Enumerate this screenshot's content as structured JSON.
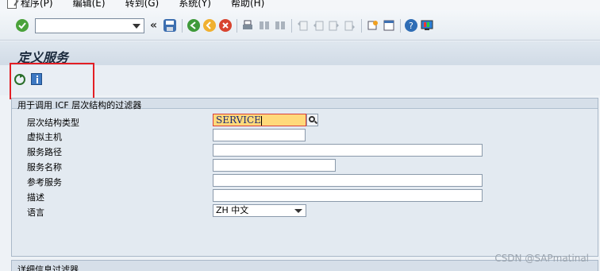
{
  "menu": {
    "items": [
      {
        "label": "程序(P)"
      },
      {
        "label": "编辑(E)"
      },
      {
        "label": "转到(G)"
      },
      {
        "label": "系统(Y)"
      },
      {
        "label": "帮助(H)"
      }
    ]
  },
  "toolbar": {
    "command_field_value": "",
    "double_arrow": "«",
    "icons": [
      "enter-icon",
      "save-icon",
      "back-icon",
      "exit-icon",
      "cancel-icon",
      "print-icon",
      "find-icon",
      "find-next-icon",
      "first-page-icon",
      "prev-page-icon",
      "next-page-icon",
      "last-page-icon",
      "create-session-icon",
      "shortcut-icon",
      "help-icon",
      "customize-layout-icon"
    ]
  },
  "title": "定义服务",
  "app_toolbar": {
    "icons": [
      "execute-icon",
      "info-icon"
    ]
  },
  "filter_group": {
    "title": "用于调用 ICF 层次结构的过滤器",
    "fields": [
      {
        "label": "层次结构类型",
        "value": "SERVICE"
      },
      {
        "label": "虚拟主机",
        "value": ""
      },
      {
        "label": "服务路径",
        "value": ""
      },
      {
        "label": "服务名称",
        "value": ""
      },
      {
        "label": "参考服务",
        "value": ""
      },
      {
        "label": "描述",
        "value": ""
      },
      {
        "label": "语言",
        "value": "ZH 中文"
      }
    ]
  },
  "detail_group": {
    "title": "详细信息过滤器"
  },
  "watermark": "CSDN @SAPmatinal"
}
